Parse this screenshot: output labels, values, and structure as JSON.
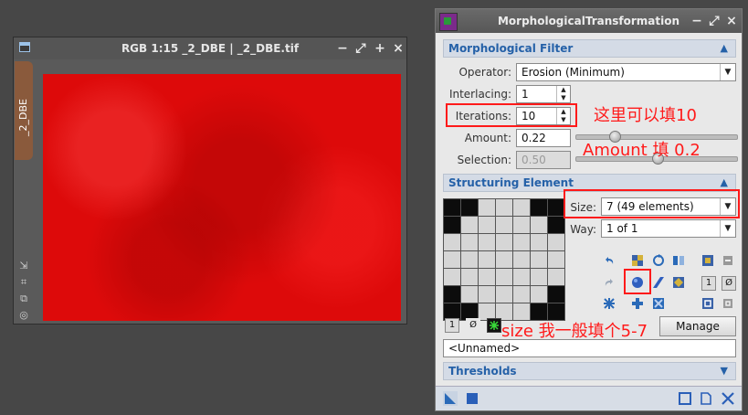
{
  "image_window": {
    "title": "RGB 1:15 _2_DBE | _2_DBE.tif",
    "view_tab": "_2_DBE",
    "buttons": [
      "−",
      "⤢",
      "+",
      "×"
    ]
  },
  "process_window": {
    "title": "MorphologicalTransformation",
    "morph_filter": {
      "section_label": "Morphological Filter",
      "operator_label": "Operator:",
      "operator_value": "Erosion (Minimum)",
      "interlacing_label": "Interlacing:",
      "interlacing_value": "1",
      "iterations_label": "Iterations:",
      "iterations_value": "10",
      "amount_label": "Amount:",
      "amount_value": "0.22",
      "amount_slider": 0.22,
      "selection_label": "Selection:",
      "selection_value": "0.50",
      "selection_slider": 0.5
    },
    "structuring": {
      "section_label": "Structuring Element",
      "size_label": "Size:",
      "size_value": "7  (49 elements)",
      "way_label": "Way:",
      "way_value": "1 of 1",
      "grid": [
        [
          1,
          1,
          0,
          0,
          0,
          1,
          1
        ],
        [
          1,
          0,
          0,
          0,
          0,
          0,
          1
        ],
        [
          0,
          0,
          0,
          0,
          0,
          0,
          0
        ],
        [
          0,
          0,
          0,
          0,
          0,
          0,
          0
        ],
        [
          0,
          0,
          0,
          0,
          0,
          0,
          0
        ],
        [
          1,
          0,
          0,
          0,
          0,
          0,
          1
        ],
        [
          1,
          1,
          0,
          0,
          0,
          1,
          1
        ]
      ],
      "small_buttons": [
        "1",
        "Ø"
      ],
      "manage_label": "Manage",
      "name_value": "<Unnamed>"
    },
    "thresholds": {
      "section_label": "Thresholds"
    }
  },
  "annotations": {
    "iterations_note": "这里可以填10",
    "amount_note": "Amount 填 0.2",
    "size_note": "size 我一般填个5-7"
  },
  "colors": {
    "annotation_red": "#ff1a1a",
    "section_blue": "#2561a8",
    "image_red": "#dd0a0a"
  }
}
